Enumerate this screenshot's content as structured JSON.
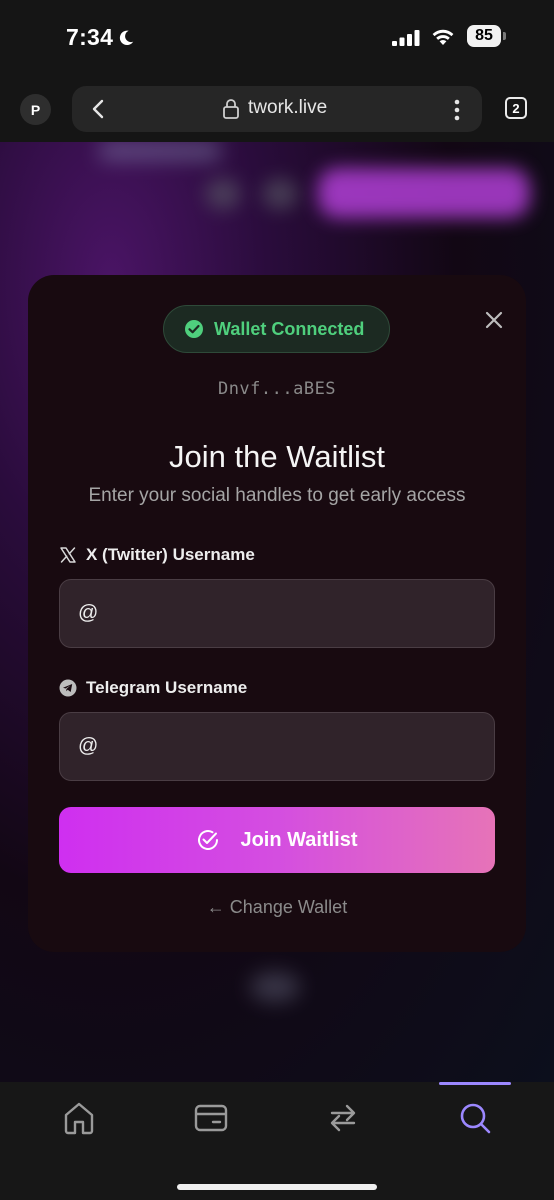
{
  "status_bar": {
    "time": "7:34",
    "battery": "85"
  },
  "browser": {
    "profile_initial": "P",
    "url": "twork.live",
    "tab_count": "2"
  },
  "modal": {
    "badge_text": "Wallet Connected",
    "wallet_address": "Dnvf...aBES",
    "title": "Join the Waitlist",
    "subtitle": "Enter your social handles to get early access",
    "twitter_label": "X (Twitter) Username",
    "twitter_placeholder": "@",
    "telegram_label": "Telegram Username",
    "telegram_placeholder": "@",
    "join_button_label": "Join Waitlist",
    "change_wallet_label": "← Change Wallet"
  },
  "bottom_nav": {
    "items": [
      {
        "icon": "home-icon"
      },
      {
        "icon": "wallet-icon"
      },
      {
        "icon": "swap-icon"
      },
      {
        "icon": "search-icon",
        "active": true
      }
    ],
    "active_color": "#9c88ff"
  },
  "colors": {
    "success": "#4fcf7d",
    "gradient_start": "#cf2ff0",
    "gradient_end": "#e673b8",
    "modal_bg": "#180a10"
  }
}
